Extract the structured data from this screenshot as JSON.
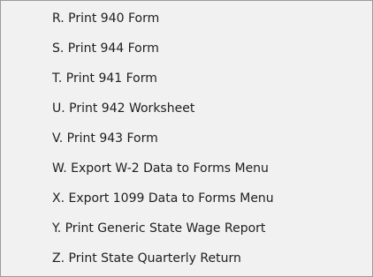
{
  "menu": {
    "items": [
      {
        "label": "R. Print 940 Form"
      },
      {
        "label": "S. Print 944 Form"
      },
      {
        "label": "T. Print 941 Form"
      },
      {
        "label": "U. Print 942 Worksheet"
      },
      {
        "label": "V. Print 943 Form"
      },
      {
        "label": "W. Export W-2 Data to Forms Menu"
      },
      {
        "label": "X. Export 1099 Data to Forms Menu"
      },
      {
        "label": "Y. Print Generic State Wage Report"
      },
      {
        "label": "Z. Print State Quarterly Return"
      }
    ]
  },
  "colors": {
    "background": "#f1f1f1",
    "border": "#9a9a9a",
    "text": "#1e1e1e"
  }
}
